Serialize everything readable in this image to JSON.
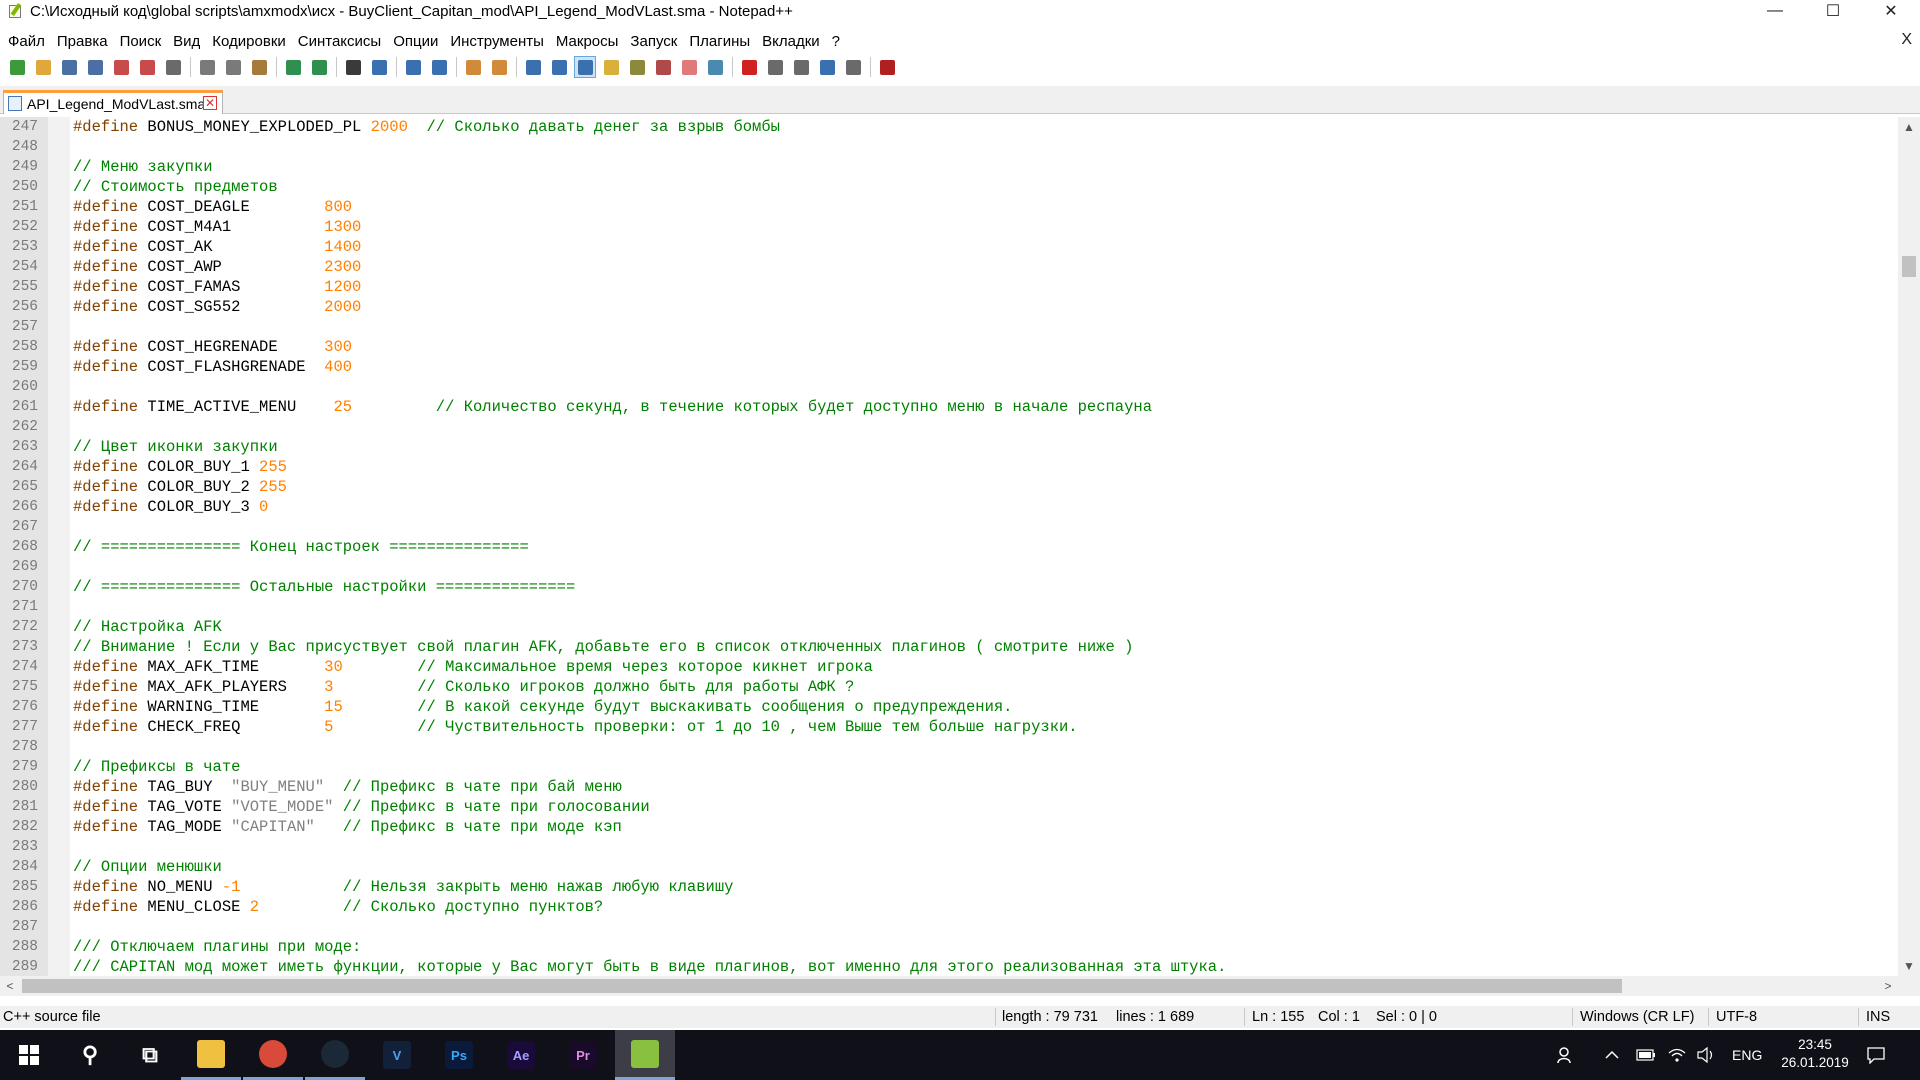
{
  "window": {
    "title": "C:\\Исходный код\\global scripts\\amxmodx\\исх - BuyClient_Capitan_mod\\API_Legend_ModVLast.sma - Notepad++",
    "minimize": "—",
    "maximize": "☐",
    "close": "✕"
  },
  "menu": {
    "items": [
      "Файл",
      "Правка",
      "Поиск",
      "Вид",
      "Кодировки",
      "Синтаксисы",
      "Опции",
      "Инструменты",
      "Макросы",
      "Запуск",
      "Плагины",
      "Вкладки",
      "?"
    ],
    "close_doc": "X"
  },
  "toolbar": {
    "buttons": [
      {
        "name": "new-icon",
        "color": "#3c9a3c"
      },
      {
        "name": "open-icon",
        "color": "#e0a83a"
      },
      {
        "name": "save-icon",
        "color": "#4a6fa5"
      },
      {
        "name": "save-all-icon",
        "color": "#4a6fa5"
      },
      {
        "name": "close-icon",
        "color": "#c94a4a"
      },
      {
        "name": "close-all-icon",
        "color": "#c94a4a"
      },
      {
        "name": "print-icon",
        "color": "#6a6a6a"
      },
      {
        "name": "cut-icon",
        "color": "#7a7a7a"
      },
      {
        "name": "copy-icon",
        "color": "#7a7a7a"
      },
      {
        "name": "paste-icon",
        "color": "#a57a3a"
      },
      {
        "name": "undo-icon",
        "color": "#2f8f4f"
      },
      {
        "name": "redo-icon",
        "color": "#2f8f4f"
      },
      {
        "name": "find-icon",
        "color": "#3a3a3a"
      },
      {
        "name": "replace-icon",
        "color": "#3a6fb0"
      },
      {
        "name": "zoom-in-icon",
        "color": "#3a6fb0"
      },
      {
        "name": "zoom-out-icon",
        "color": "#3a6fb0"
      },
      {
        "name": "sync-vertical-icon",
        "color": "#d08a3a"
      },
      {
        "name": "sync-horizontal-icon",
        "color": "#d08a3a"
      },
      {
        "name": "word-wrap-icon",
        "color": "#3a6fb0"
      },
      {
        "name": "show-all-chars-icon",
        "color": "#3a6fb0"
      },
      {
        "name": "indent-guide-icon",
        "color": "#3a6fb0"
      },
      {
        "name": "udl-icon",
        "color": "#d8b03a"
      },
      {
        "name": "doc-map-icon",
        "color": "#8a8a3a"
      },
      {
        "name": "function-list-icon",
        "color": "#b04a4a"
      },
      {
        "name": "folder-workspace-icon",
        "color": "#e07a7a"
      },
      {
        "name": "monitoring-icon",
        "color": "#4a8ab0"
      },
      {
        "name": "record-macro-icon",
        "color": "#d02020"
      },
      {
        "name": "stop-macro-icon",
        "color": "#6a6a6a"
      },
      {
        "name": "play-macro-icon",
        "color": "#6a6a6a"
      },
      {
        "name": "run-macro-multiple-icon",
        "color": "#3a6fb0"
      },
      {
        "name": "save-macro-icon",
        "color": "#6a6a6a"
      },
      {
        "name": "spellcheck-icon",
        "color": "#b02020"
      }
    ]
  },
  "tab": {
    "label": "API_Legend_ModVLast.sma",
    "close": "✕"
  },
  "editor": {
    "lines": [
      {
        "n": "247",
        "parts": [
          [
            "pp",
            "#define"
          ],
          [
            "id",
            " BONUS_MONEY_EXPLODED_PL "
          ],
          [
            "num",
            "2000"
          ],
          [
            "id",
            "  "
          ],
          [
            "cm",
            "// Сколько давать денег за взрыв бомбы"
          ]
        ]
      },
      {
        "n": "248",
        "parts": []
      },
      {
        "n": "249",
        "parts": [
          [
            "cm",
            "// Меню закупки"
          ]
        ]
      },
      {
        "n": "250",
        "parts": [
          [
            "cm",
            "// Стоимость предметов"
          ]
        ]
      },
      {
        "n": "251",
        "parts": [
          [
            "pp",
            "#define"
          ],
          [
            "id",
            " COST_DEAGLE        "
          ],
          [
            "num",
            "800"
          ]
        ]
      },
      {
        "n": "252",
        "parts": [
          [
            "pp",
            "#define"
          ],
          [
            "id",
            " COST_M4A1          "
          ],
          [
            "num",
            "1300"
          ]
        ]
      },
      {
        "n": "253",
        "parts": [
          [
            "pp",
            "#define"
          ],
          [
            "id",
            " COST_AK            "
          ],
          [
            "num",
            "1400"
          ]
        ]
      },
      {
        "n": "254",
        "parts": [
          [
            "pp",
            "#define"
          ],
          [
            "id",
            " COST_AWP           "
          ],
          [
            "num",
            "2300"
          ]
        ]
      },
      {
        "n": "255",
        "parts": [
          [
            "pp",
            "#define"
          ],
          [
            "id",
            " COST_FAMAS         "
          ],
          [
            "num",
            "1200"
          ]
        ]
      },
      {
        "n": "256",
        "parts": [
          [
            "pp",
            "#define"
          ],
          [
            "id",
            " COST_SG552         "
          ],
          [
            "num",
            "2000"
          ]
        ]
      },
      {
        "n": "257",
        "parts": []
      },
      {
        "n": "258",
        "parts": [
          [
            "pp",
            "#define"
          ],
          [
            "id",
            " COST_HEGRENADE     "
          ],
          [
            "num",
            "300"
          ]
        ]
      },
      {
        "n": "259",
        "parts": [
          [
            "pp",
            "#define"
          ],
          [
            "id",
            " COST_FLASHGRENADE  "
          ],
          [
            "num",
            "400"
          ]
        ]
      },
      {
        "n": "260",
        "parts": []
      },
      {
        "n": "261",
        "parts": [
          [
            "pp",
            "#define"
          ],
          [
            "id",
            " TIME_ACTIVE_MENU    "
          ],
          [
            "num",
            "25"
          ],
          [
            "id",
            "         "
          ],
          [
            "cm",
            "// Количество секунд, в течение которых будет доступно меню в начале респауна"
          ]
        ]
      },
      {
        "n": "262",
        "parts": []
      },
      {
        "n": "263",
        "parts": [
          [
            "cm",
            "// Цвет иконки закупки"
          ]
        ]
      },
      {
        "n": "264",
        "parts": [
          [
            "pp",
            "#define"
          ],
          [
            "id",
            " COLOR_BUY_1 "
          ],
          [
            "num",
            "255"
          ]
        ]
      },
      {
        "n": "265",
        "parts": [
          [
            "pp",
            "#define"
          ],
          [
            "id",
            " COLOR_BUY_2 "
          ],
          [
            "num",
            "255"
          ]
        ]
      },
      {
        "n": "266",
        "parts": [
          [
            "pp",
            "#define"
          ],
          [
            "id",
            " COLOR_BUY_3 "
          ],
          [
            "num",
            "0"
          ]
        ]
      },
      {
        "n": "267",
        "parts": []
      },
      {
        "n": "268",
        "parts": [
          [
            "cm",
            "// =============== Конец настроек ==============="
          ]
        ]
      },
      {
        "n": "269",
        "parts": []
      },
      {
        "n": "270",
        "parts": [
          [
            "cm",
            "// =============== Остальные настройки ==============="
          ]
        ]
      },
      {
        "n": "271",
        "parts": []
      },
      {
        "n": "272",
        "parts": [
          [
            "cm",
            "// Настройка AFK"
          ]
        ]
      },
      {
        "n": "273",
        "parts": [
          [
            "cm",
            "// Внимание ! Если у Вас присуствует свой плагин AFK, добавьте его в список отключенных плагинов ( смотрите ниже )"
          ]
        ]
      },
      {
        "n": "274",
        "parts": [
          [
            "pp",
            "#define"
          ],
          [
            "id",
            " MAX_AFK_TIME       "
          ],
          [
            "num",
            "30"
          ],
          [
            "id",
            "        "
          ],
          [
            "cm",
            "// Максимальное время через которое кикнет игрока"
          ]
        ]
      },
      {
        "n": "275",
        "parts": [
          [
            "pp",
            "#define"
          ],
          [
            "id",
            " MAX_AFK_PLAYERS    "
          ],
          [
            "num",
            "3"
          ],
          [
            "id",
            "         "
          ],
          [
            "cm",
            "// Сколько игроков должно быть для работы АФК ?"
          ]
        ]
      },
      {
        "n": "276",
        "parts": [
          [
            "pp",
            "#define"
          ],
          [
            "id",
            " WARNING_TIME       "
          ],
          [
            "num",
            "15"
          ],
          [
            "id",
            "        "
          ],
          [
            "cm",
            "// В какой секунде будут выскакивать сообщения о предупреждения."
          ]
        ]
      },
      {
        "n": "277",
        "parts": [
          [
            "pp",
            "#define"
          ],
          [
            "id",
            " CHECK_FREQ         "
          ],
          [
            "num",
            "5"
          ],
          [
            "id",
            "         "
          ],
          [
            "cm",
            "// Чуствительность проверки: от 1 до 10 , чем Выше тем больше нагрузки."
          ]
        ]
      },
      {
        "n": "278",
        "parts": []
      },
      {
        "n": "279",
        "parts": [
          [
            "cm",
            "// Префиксы в чате"
          ]
        ]
      },
      {
        "n": "280",
        "parts": [
          [
            "pp",
            "#define"
          ],
          [
            "id",
            " TAG_BUY  "
          ],
          [
            "str",
            "\"BUY_MENU\""
          ],
          [
            "id",
            "  "
          ],
          [
            "cm",
            "// Префикс в чате при бай меню"
          ]
        ]
      },
      {
        "n": "281",
        "parts": [
          [
            "pp",
            "#define"
          ],
          [
            "id",
            " TAG_VOTE "
          ],
          [
            "str",
            "\"VOTE_MODE\""
          ],
          [
            "id",
            " "
          ],
          [
            "cm",
            "// Префикс в чате при голосовании"
          ]
        ]
      },
      {
        "n": "282",
        "parts": [
          [
            "pp",
            "#define"
          ],
          [
            "id",
            " TAG_MODE "
          ],
          [
            "str",
            "\"CAPITAN\""
          ],
          [
            "id",
            "   "
          ],
          [
            "cm",
            "// Префикс в чате при моде кэп"
          ]
        ]
      },
      {
        "n": "283",
        "parts": []
      },
      {
        "n": "284",
        "parts": [
          [
            "cm",
            "// Опции менюшки"
          ]
        ]
      },
      {
        "n": "285",
        "parts": [
          [
            "pp",
            "#define"
          ],
          [
            "id",
            " NO_MENU "
          ],
          [
            "num",
            "-1"
          ],
          [
            "id",
            "           "
          ],
          [
            "cm",
            "// Нельзя закрыть меню нажав любую клавишу"
          ]
        ]
      },
      {
        "n": "286",
        "parts": [
          [
            "pp",
            "#define"
          ],
          [
            "id",
            " MENU_CLOSE "
          ],
          [
            "num",
            "2"
          ],
          [
            "id",
            "         "
          ],
          [
            "cm",
            "// Сколько доступно пунктов?"
          ]
        ]
      },
      {
        "n": "287",
        "parts": []
      },
      {
        "n": "288",
        "parts": [
          [
            "cm",
            "/// Отключаем плагины при моде:"
          ]
        ]
      },
      {
        "n": "289",
        "parts": [
          [
            "cm",
            "/// CAPITAN мод может иметь функции, которые у Вас могут быть в виде плагинов, вот именно для этого реализованная эта штука."
          ]
        ]
      }
    ]
  },
  "scroll": {
    "up": "▲",
    "down": "▼",
    "left": "<",
    "right": ">"
  },
  "status": {
    "filetype": "C++ source file",
    "length": "length : 79 731",
    "lines": "lines : 1 689",
    "ln": "Ln : 155",
    "col": "Col : 1",
    "sel": "Sel : 0 | 0",
    "eol": "Windows (CR LF)",
    "encoding": "UTF-8",
    "mode": "INS"
  },
  "taskbar": {
    "apps": [
      {
        "name": "search-taskbar-icon",
        "label": "⚲",
        "bg": "transparent",
        "fg": "#ffffff",
        "state": ""
      },
      {
        "name": "task-view-icon",
        "label": "⧉",
        "bg": "transparent",
        "fg": "#ffffff",
        "state": ""
      },
      {
        "name": "file-explorer-icon",
        "label": "",
        "bg": "#f0c040",
        "fg": "#7a5a10",
        "state": "running"
      },
      {
        "name": "chrome-icon",
        "label": "",
        "bg": "#d94a3a",
        "fg": "#ffffff",
        "state": "running"
      },
      {
        "name": "steam-icon",
        "label": "",
        "bg": "#1b2838",
        "fg": "#ffffff",
        "state": "running"
      },
      {
        "name": "visual-studio-icon",
        "label": "V",
        "bg": "#12203a",
        "fg": "#4aa0f0",
        "state": ""
      },
      {
        "name": "photoshop-icon",
        "label": "Ps",
        "bg": "#0a1a3a",
        "fg": "#31a8ff",
        "state": ""
      },
      {
        "name": "after-effects-icon",
        "label": "Ae",
        "bg": "#1a0a3a",
        "fg": "#a4a0ff",
        "state": ""
      },
      {
        "name": "premiere-icon",
        "label": "Pr",
        "bg": "#1a0a2a",
        "fg": "#e08ae8",
        "state": ""
      },
      {
        "name": "notepadpp-icon",
        "label": "",
        "bg": "#8ac040",
        "fg": "#ffffff",
        "state": "active"
      }
    ],
    "lang": "ENG",
    "time": "23:45",
    "date": "26.01.2019"
  }
}
